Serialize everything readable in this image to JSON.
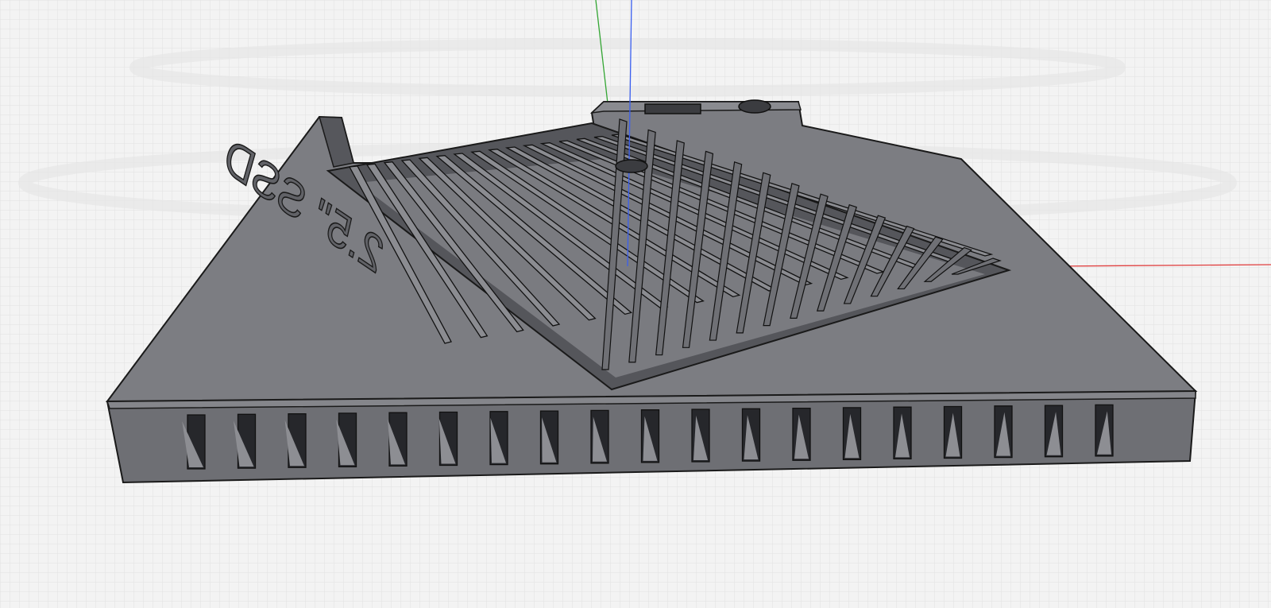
{
  "viewport": {
    "background_color": "#f3f3f3",
    "grid_color": "#dcdcdc",
    "model_color": "#7c7d82",
    "model_dark_color": "#4a4b50",
    "axis_colors": {
      "x": "#e04040",
      "y": "#33a533",
      "z": "#3a5ff0"
    }
  },
  "model": {
    "engraved_label": "2.5\" SSD",
    "icon": "ssd-bracket-model"
  }
}
